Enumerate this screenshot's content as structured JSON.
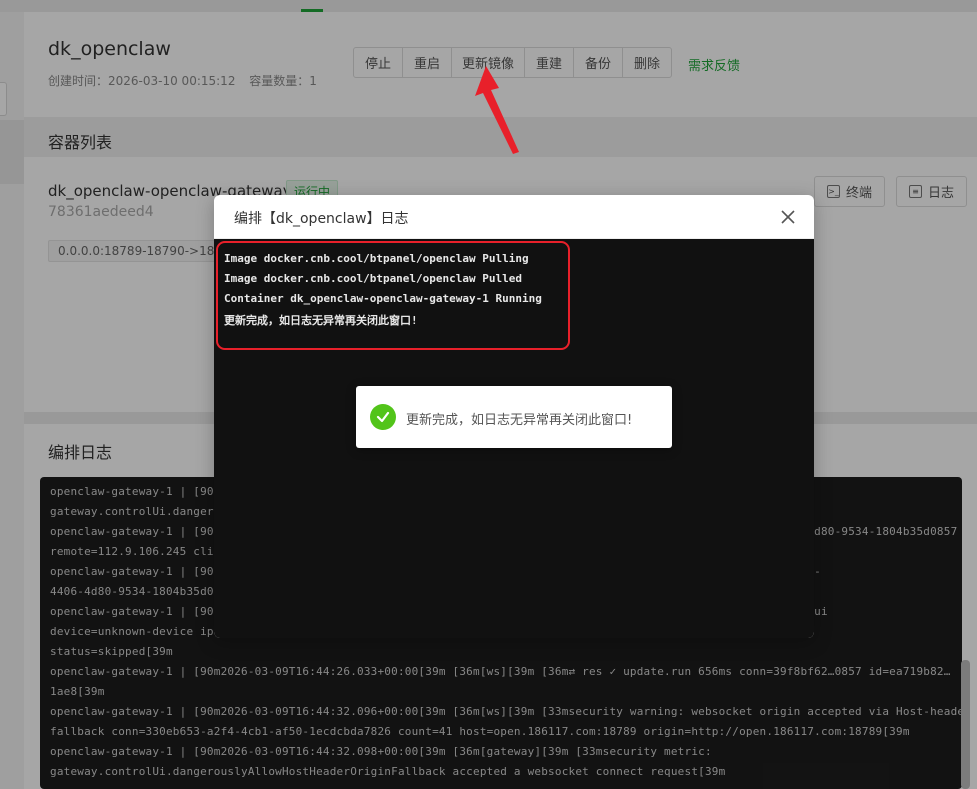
{
  "container": {
    "title": "dk_openclaw",
    "created_label": "创建时间：2026-03-10 00:15:12",
    "count_label": "容量数量：1"
  },
  "actions": {
    "buttons": [
      "停止",
      "重启",
      "更新镜像",
      "重建",
      "备份",
      "删除"
    ],
    "feedback_link": "需求反馈"
  },
  "container_list": {
    "title": "容器列表",
    "service": {
      "name": "dk_openclaw-openclaw-gateway-1",
      "status": "运行中",
      "id": "78361aedeed4",
      "ports": "0.0.0.0:18789-18790->18789-18790/tcp"
    },
    "terminal_button": "终端",
    "log_button": "日志"
  },
  "compose_log": {
    "title": "编排日志",
    "lines": [
      "openclaw-gateway-1 | [90m2026-03-09T16:44:20.510+00:00[39m [36m[gateway][39m [33msecurity metric:",
      "gateway.controlUi.dangerouslyAllowHostHeaderOriginFallback accepted a websocket connect request[39m",
      "openclaw-gateway-1 | [90m2026-03-09T16:44:20.514+00:00[39m [36m[ws][39m [36m⇄ res ✓ connect conn=39f8bf62-4406-4d80-9534-1804b35d0857",
      "remote=112.9.106.245 client=openclaw-control-ui webchat vdev[39m",
      "openclaw-gateway-1 | [90m2026-03-09T16:44:25.377+00:00[39m [36m[ws][39m [36m⇄ res ✓ update.run 8ms conn=39f8bf62-",
      "4406-4d80-9534-1804b35d0857 id=1ae8[39m",
      "openclaw-gateway-1 | [90m2026-03-09T16:44:25.381+00:00[39m [36m[gateway][39m update.run client=openclaw-control-ui",
      "device=unknown-device ip=112.9.106.245 changedPaths=<n/a> restartReason=update.run",
      "status=skipped[39m",
      "openclaw-gateway-1 | [90m2026-03-09T16:44:26.033+00:00[39m [36m[ws][39m [36m⇄ res ✓ update.run 656ms conn=39f8bf62…0857 id=ea719b82…",
      "1ae8[39m",
      "openclaw-gateway-1 | [90m2026-03-09T16:44:32.096+00:00[39m [36m[ws][39m [33msecurity warning: websocket origin accepted via Host-header",
      "fallback conn=330eb653-a2f4-4cb1-af50-1ecdcbda7826 count=41 host=open.186117.com:18789 origin=http://open.186117.com:18789[39m",
      "openclaw-gateway-1 | [90m2026-03-09T16:44:32.098+00:00[39m [36m[gateway][39m [33msecurity metric:",
      "gateway.controlUi.dangerouslyAllowHostHeaderOriginFallback accepted a websocket connect request[39m"
    ]
  },
  "modal": {
    "title": "编排【dk_openclaw】日志",
    "log_lines": [
      "Image docker.cnb.cool/btpanel/openclaw Pulling",
      "Image docker.cnb.cool/btpanel/openclaw Pulled",
      "Container dk_openclaw-openclaw-gateway-1 Running",
      "更新完成，如日志无异常再关闭此窗口!"
    ]
  },
  "toast": {
    "message": "更新完成，如日志无异常再关闭此窗口!"
  },
  "colors": {
    "accent_green": "#20a53a",
    "annotation_red": "#e8202a",
    "success_green": "#52c41a"
  }
}
